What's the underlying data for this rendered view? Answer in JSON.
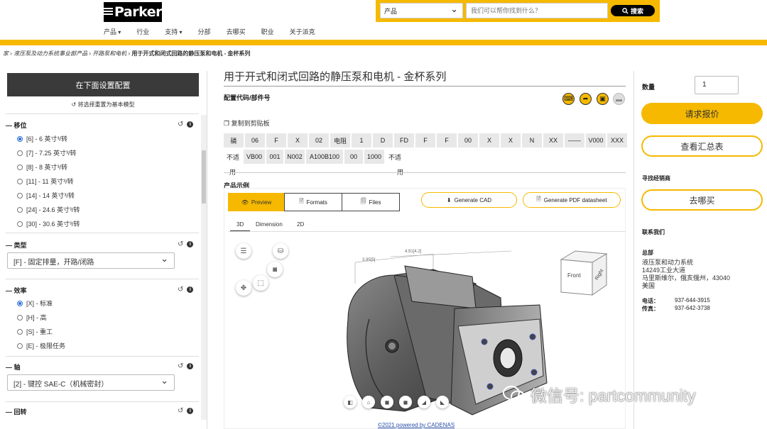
{
  "header": {
    "logo_text": "Parker",
    "nav": [
      "产品",
      "行业",
      "支持",
      "分部",
      "去哪买",
      "职业",
      "关于派克"
    ],
    "search_category": "产品",
    "search_placeholder": "我们可以帮你找到什么？",
    "search_button": "搜索"
  },
  "breadcrumb": {
    "items": [
      "家",
      "液压泵及动力系统事业部产品",
      "开路泵和电机"
    ],
    "current": "用于开式和闭式回路的静压泵和电机 - 金杯系列"
  },
  "config": {
    "header": "在下面设置配置",
    "reset": "将选择重置为基本模型",
    "displacement": {
      "title": "移位",
      "options": [
        "[6] - 6 英寸³/转",
        "[7] - 7.25 英寸³/转",
        "[8] - 8 英寸³/转",
        "[11] - 11 英寸³/转",
        "[14] - 14 英寸³/转",
        "[24] - 24.6 英寸³/转",
        "[30] - 30.6 英寸³/转"
      ],
      "selected": 0
    },
    "type": {
      "title": "类型",
      "value": "[F] - 固定排量，开路/闭路"
    },
    "efficiency": {
      "title": "效率",
      "options": [
        "[X] - 标准",
        "[H] - 高",
        "[S] - 重工",
        "[E] - 极限任务"
      ],
      "selected": 0
    },
    "shaft": {
      "title": "轴",
      "value": "[2] - 键控 SAE-C（机械密封）"
    },
    "rotation": {
      "title": "回转"
    }
  },
  "main": {
    "title": "用于开式和闭式回路的静压泵和电机 - 金杯系列",
    "code_label": "配置代码/部件号",
    "copy": "复制到剪贴板",
    "code_row1": [
      "磷",
      "06",
      "F",
      "X",
      "02",
      "电阻",
      "1",
      "D",
      "FD",
      "F",
      "F",
      "00",
      "X",
      "X",
      "N",
      "XX",
      "——",
      "V000",
      "XXX"
    ],
    "code_row2": [
      "不适",
      "VB00",
      "001",
      "N002",
      "A100B100",
      "00",
      "1000",
      "不适"
    ],
    "code_row3": [
      "用",
      "用"
    ],
    "sample_label": "产品示例",
    "viewer_tabs": [
      "Preview",
      "Formats",
      "Files"
    ],
    "viewer_buttons": [
      "Generate CAD",
      "Generate PDF datasheet"
    ],
    "sub_tabs": [
      "3D",
      "Dimension",
      "2D"
    ],
    "cube_faces": [
      "Front",
      "Right"
    ],
    "dimension_labels": [
      "4.91[4.2]",
      "3.95[5]"
    ],
    "credit": "©2021 powered by CADENAS",
    "watermark": "微信号: partcommunity"
  },
  "sidebar_right": {
    "qty_label": "数量",
    "qty_value": "1",
    "quote_button": "请求报价",
    "summary_button": "查看汇总表",
    "dealer_label": "寻找经销商",
    "where_button": "去哪买",
    "contact_label": "联系我们",
    "hq_label": "总部",
    "address": [
      "液压泵和动力系统",
      "14249工业大道",
      "马里斯维尔，俄亥俄州，43040",
      "美国"
    ],
    "phone_label": "电话：",
    "phone": "937-644-3915",
    "fax_label": "传真：",
    "fax": "937-642-3738"
  },
  "colors": {
    "accent": "#f6b900",
    "header_dark": "#3a3a3a",
    "link": "#2a4fa8",
    "radio_selected": "#2a6cd6"
  }
}
